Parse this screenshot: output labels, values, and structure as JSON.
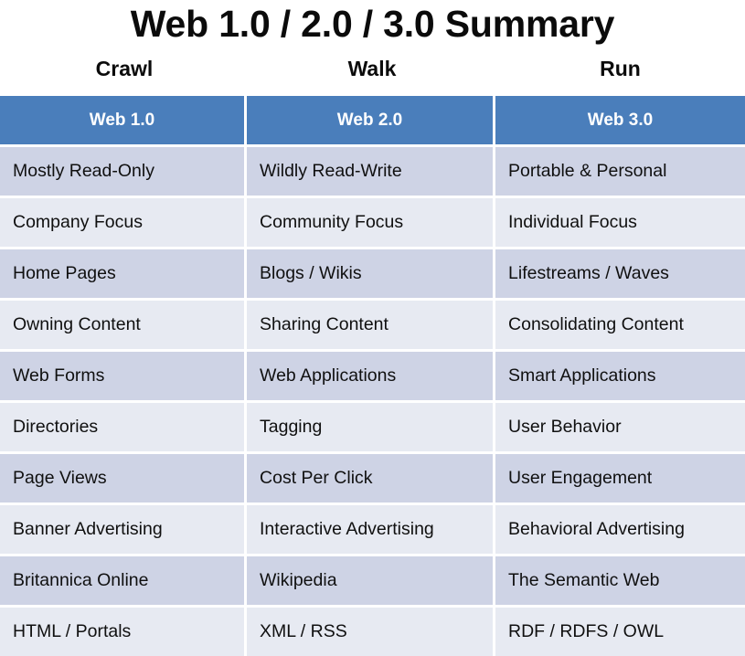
{
  "title": "Web 1.0 / 2.0 / 3.0 Summary",
  "stages": [
    "Crawl",
    "Walk",
    "Run"
  ],
  "colors": {
    "header_blue": "#4a7ebb",
    "row_dark": "#ced3e5",
    "row_light": "#e7eaf2",
    "text": "#101010",
    "header_text": "#ffffff",
    "background": "#ffffff"
  },
  "table": {
    "headers": [
      "Web 1.0",
      "Web 2.0",
      "Web 3.0"
    ],
    "rows": [
      [
        "Mostly Read-Only",
        "Wildly Read-Write",
        "Portable & Personal"
      ],
      [
        "Company Focus",
        "Community Focus",
        "Individual Focus"
      ],
      [
        "Home Pages",
        "Blogs / Wikis",
        "Lifestreams / Waves"
      ],
      [
        "Owning Content",
        "Sharing Content",
        "Consolidating Content"
      ],
      [
        "Web Forms",
        "Web Applications",
        "Smart Applications"
      ],
      [
        "Directories",
        "Tagging",
        "User Behavior"
      ],
      [
        "Page Views",
        "Cost Per Click",
        "User Engagement"
      ],
      [
        "Banner Advertising",
        "Interactive Advertising",
        "Behavioral Advertising"
      ],
      [
        "Britannica Online",
        "Wikipedia",
        "The Semantic Web"
      ],
      [
        "HTML / Portals",
        "XML / RSS",
        "RDF / RDFS / OWL"
      ]
    ]
  }
}
